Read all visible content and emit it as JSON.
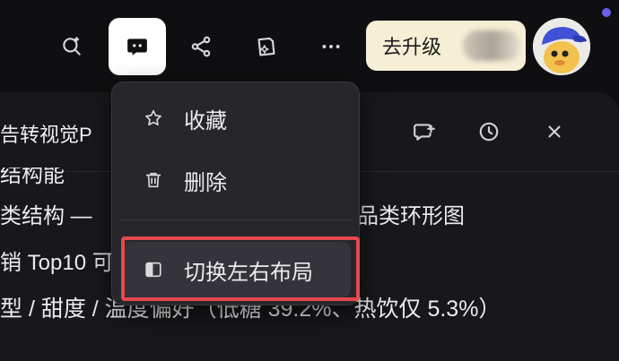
{
  "toolbar": {
    "upgrade_label": "去升级"
  },
  "panel": {
    "title": "告转视觉P",
    "lines": [
      "结构能",
      "类结构 — ",
      "品类环形图",
      "销 Top10 可",
      "型 / 甜度 / 温度偏好（低糖 39.2%、热饮仅 5.3%）"
    ]
  },
  "menu": {
    "items": [
      {
        "label": "收藏",
        "icon": "star-icon"
      },
      {
        "label": "删除",
        "icon": "trash-icon"
      },
      {
        "label": "切换左右布局",
        "icon": "split-layout-icon"
      }
    ]
  },
  "colors": {
    "accent": "#6b61f0",
    "highlight_outline": "#e5484d",
    "upgrade_bg": "#f6efd6"
  }
}
